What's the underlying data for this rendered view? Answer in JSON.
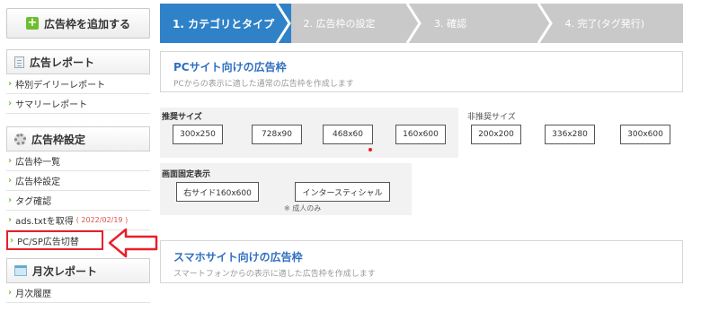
{
  "sidebar": {
    "add_button": "広告枠を追加する",
    "report": {
      "title": "広告レポート",
      "items": [
        "枠別デイリーレポート",
        "サマリーレポート"
      ]
    },
    "settings": {
      "title": "広告枠設定",
      "items": [
        "広告枠一覧",
        "広告枠設定",
        "タグ確認",
        "ads.txtを取得",
        "PC/SP広告切替"
      ],
      "ads_txt_date": "( 2022/02/19 )"
    },
    "monthly": {
      "title": "月次レポート",
      "items": [
        "月次履歴"
      ]
    }
  },
  "steps": [
    "1. カテゴリとタイプ",
    "2. 広告枠の設定",
    "3. 確認",
    "4. 完了(タグ発行)"
  ],
  "pc": {
    "title": "PCサイト向けの広告枠",
    "subtitle": "PCからの表示に適した通常の広告枠を作成します",
    "recommended_label": "推奨サイズ",
    "recommended_sizes": [
      "300x250",
      "728x90",
      "468x60",
      "160x600"
    ],
    "non_recommended_label": "非推奨サイズ",
    "non_recommended_sizes": [
      "200x200",
      "336x280",
      "300x600"
    ],
    "fixed_label": "画面固定表示",
    "fixed_options": [
      "右サイド160x600",
      "インタースティシャル"
    ],
    "adult_note": "※ 成人のみ"
  },
  "sp": {
    "title": "スマホサイト向けの広告枠",
    "subtitle": "スマートフォンからの表示に適した広告枠を作成します"
  },
  "colors": {
    "accent": "#2f82c8",
    "title_blue": "#2f6fc0",
    "highlight_red": "#e8202a",
    "chevron_green": "#6cbf2e",
    "step_inactive": "#c9c9c9"
  }
}
